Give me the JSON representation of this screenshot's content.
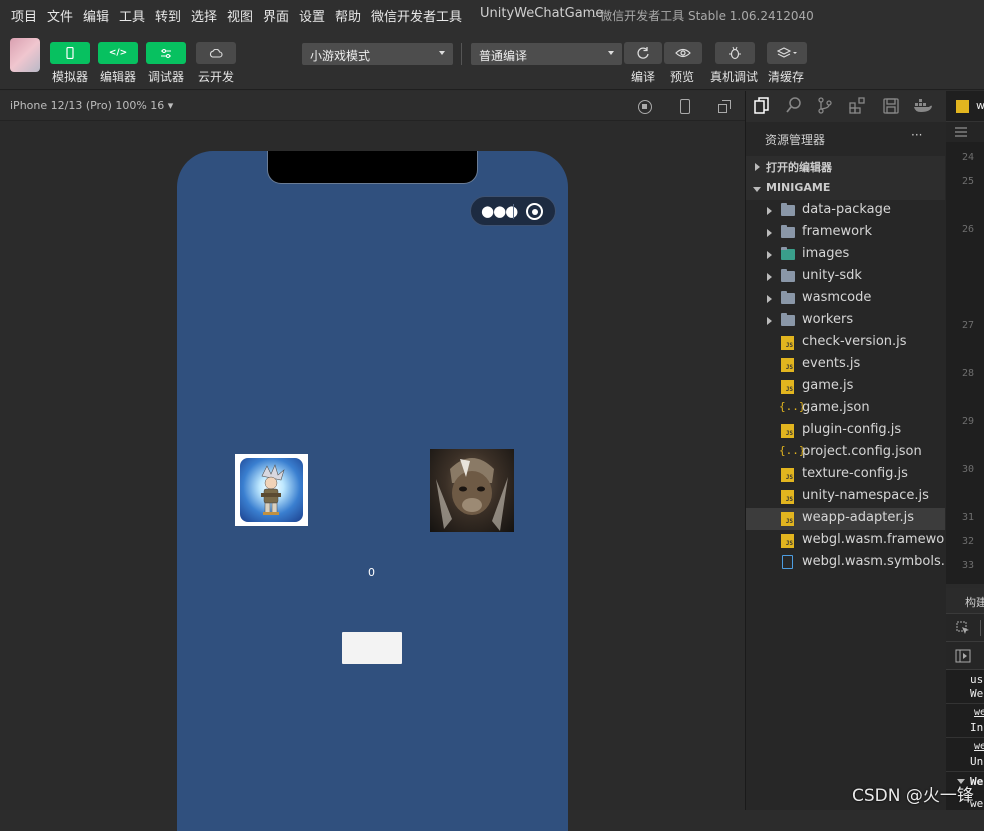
{
  "menu": [
    "项目",
    "文件",
    "编辑",
    "工具",
    "转到",
    "选择",
    "视图",
    "界面",
    "设置",
    "帮助",
    "微信开发者工具"
  ],
  "window_title": "UnityWeChatGame",
  "window_subtitle": "- 微信开发者工具 Stable 1.06.2412040",
  "toolbar": {
    "left_buttons": [
      {
        "label": "模拟器",
        "icon": "phone-icon"
      },
      {
        "label": "编辑器",
        "icon": "code-icon"
      },
      {
        "label": "调试器",
        "icon": "debug-icon"
      },
      {
        "label": "云开发",
        "icon": "cloud-icon"
      }
    ],
    "mode_select": "小游戏模式",
    "compile_select": "普通编译",
    "right_buttons": [
      {
        "label": "编译",
        "icon": "refresh-icon"
      },
      {
        "label": "预览",
        "icon": "eye-icon"
      },
      {
        "label": "真机调试",
        "icon": "bug-icon"
      },
      {
        "label": "清缓存",
        "icon": "layers-icon"
      }
    ]
  },
  "simulator": {
    "device": "iPhone 12/13 (Pro) 100% 16 ▾",
    "score": "0"
  },
  "explorer": {
    "title": "资源管理器",
    "more": "···",
    "open_editors": "打开的编辑器",
    "project": "MINIGAME",
    "items": [
      {
        "name": "data-package",
        "type": "folder"
      },
      {
        "name": "framework",
        "type": "folder"
      },
      {
        "name": "images",
        "type": "folder-img"
      },
      {
        "name": "unity-sdk",
        "type": "folder"
      },
      {
        "name": "wasmcode",
        "type": "folder"
      },
      {
        "name": "workers",
        "type": "folder"
      },
      {
        "name": "check-version.js",
        "type": "js"
      },
      {
        "name": "events.js",
        "type": "js"
      },
      {
        "name": "game.js",
        "type": "js"
      },
      {
        "name": "game.json",
        "type": "json"
      },
      {
        "name": "plugin-config.js",
        "type": "js"
      },
      {
        "name": "project.config.json",
        "type": "json"
      },
      {
        "name": "texture-config.js",
        "type": "js"
      },
      {
        "name": "unity-namespace.js",
        "type": "js"
      },
      {
        "name": "weapp-adapter.js",
        "type": "js",
        "selected": true
      },
      {
        "name": "webgl.wasm.framewor...",
        "type": "js"
      },
      {
        "name": "webgl.wasm.symbols.u...",
        "type": "file"
      }
    ]
  },
  "editor": {
    "tab": "we",
    "line_numbers": [
      "24",
      "25",
      "26",
      "27",
      "28",
      "29",
      "30",
      "31",
      "32",
      "33"
    ],
    "panel_tab": "构建",
    "console_lines": [
      "us",
      "We",
      "we",
      "In",
      "we",
      "Un",
      "We",
      "we"
    ]
  },
  "watermark": "CSDN @火一锋"
}
